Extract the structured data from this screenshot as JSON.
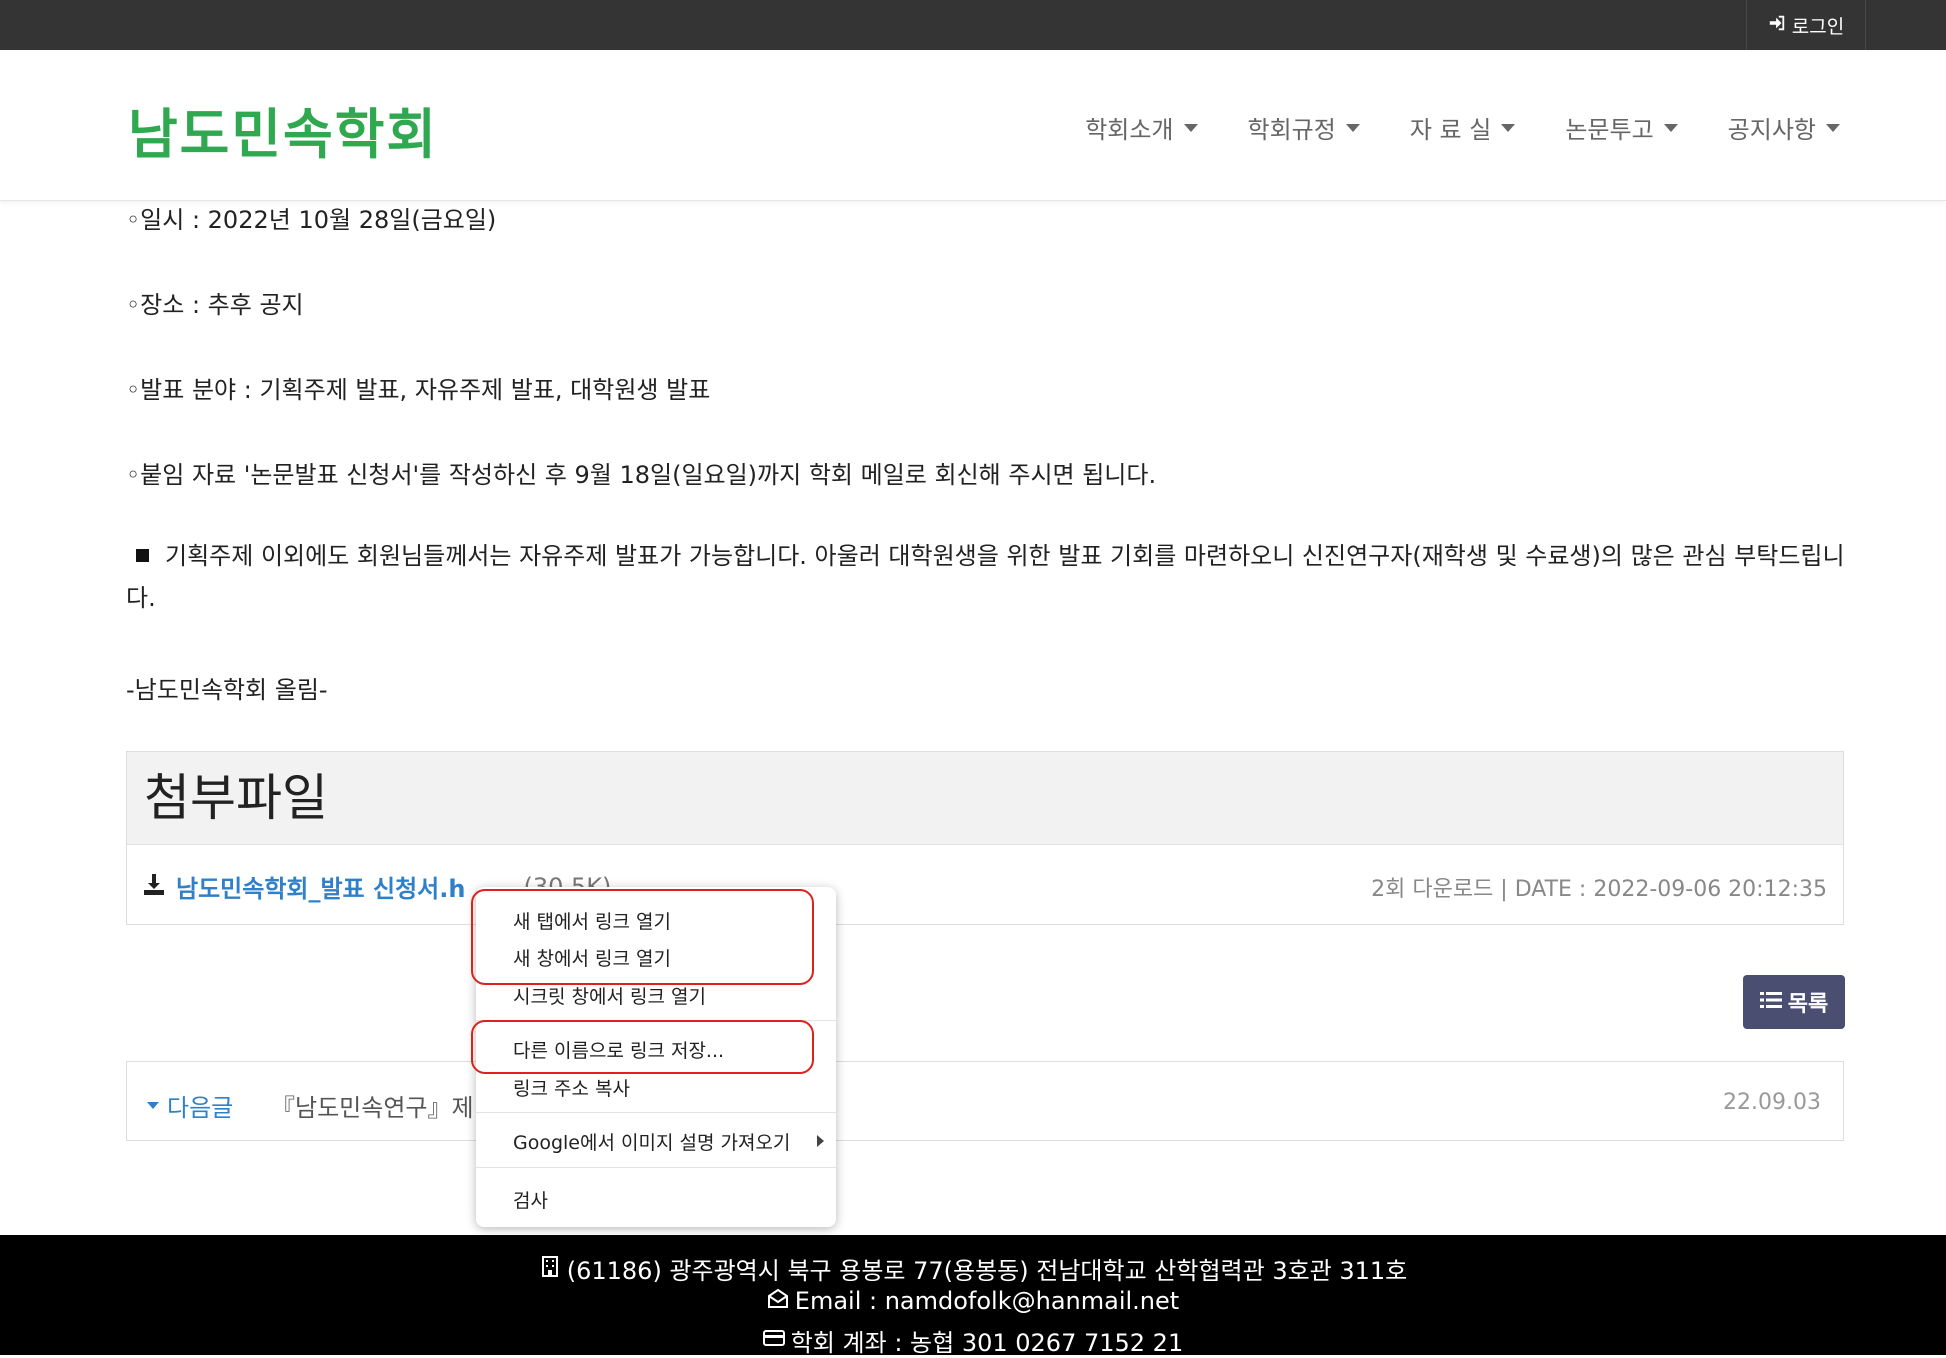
{
  "topbar": {
    "login_label": "로그인",
    "login_icon": "sign-in-icon"
  },
  "header": {
    "logo": "남도민속학회",
    "nav": [
      "학회소개",
      "학회규정",
      "자 료 실",
      "논문투고",
      "공지사항"
    ]
  },
  "content": {
    "date_line": "◦일시 : 2022년 10월 28일(금요일)",
    "place_line": "◦장소 : 추후 공지",
    "field_line": "◦발표 분야 : 기획주제 발표, 자유주제 발표, 대학원생 발표",
    "attach_line": "◦붙임 자료 '논문발표 신청서'를 작성하신 후 9월 18일(일요일)까지 학회 메일로 회신해 주시면 됩니다.",
    "notice_text": "기획주제 이외에도 회원님들께서는 자유주제 발표가 가능합니다. 아울러 대학원생을 위한 발표 기회를 마련하오니 신진연구자(재학생 및 수료생)의 많은 관심 부탁드립니다.",
    "signature": "-남도민속학회 올림-"
  },
  "attachment": {
    "heading": "첨부파일",
    "file_name": "남도민속학회_발표 신청서.h",
    "file_size": "(30.5K)",
    "meta": "2회 다운로드 | DATE : 2022-09-06 20:12:35"
  },
  "list_button": {
    "label": "목록",
    "icon": "list-icon"
  },
  "next_post": {
    "label": "다음글",
    "title": "『남도민속연구』제",
    "date": "22.09.03"
  },
  "context_menu": {
    "items": [
      "새 탭에서 링크 열기",
      "새 창에서 링크 열기",
      "시크릿 창에서 링크 열기",
      "다른 이름으로 링크 저장...",
      "링크 주소 복사",
      "Google에서 이미지 설명 가져오기",
      "검사"
    ]
  },
  "footer": {
    "address": "(61186) 광주광역시 북구 용봉로 77(용봉동) 전남대학교 산학협력관 3호관 311호",
    "email": "Email : namdofolk@hanmail.net",
    "account": "학회 계좌 : 농협 301 0267 7152 21"
  },
  "colors": {
    "logo": "#2fa84f",
    "link": "#2f80c8",
    "highlight": "#e0201b",
    "topbar": "#343434",
    "button": "#4a4f72"
  }
}
